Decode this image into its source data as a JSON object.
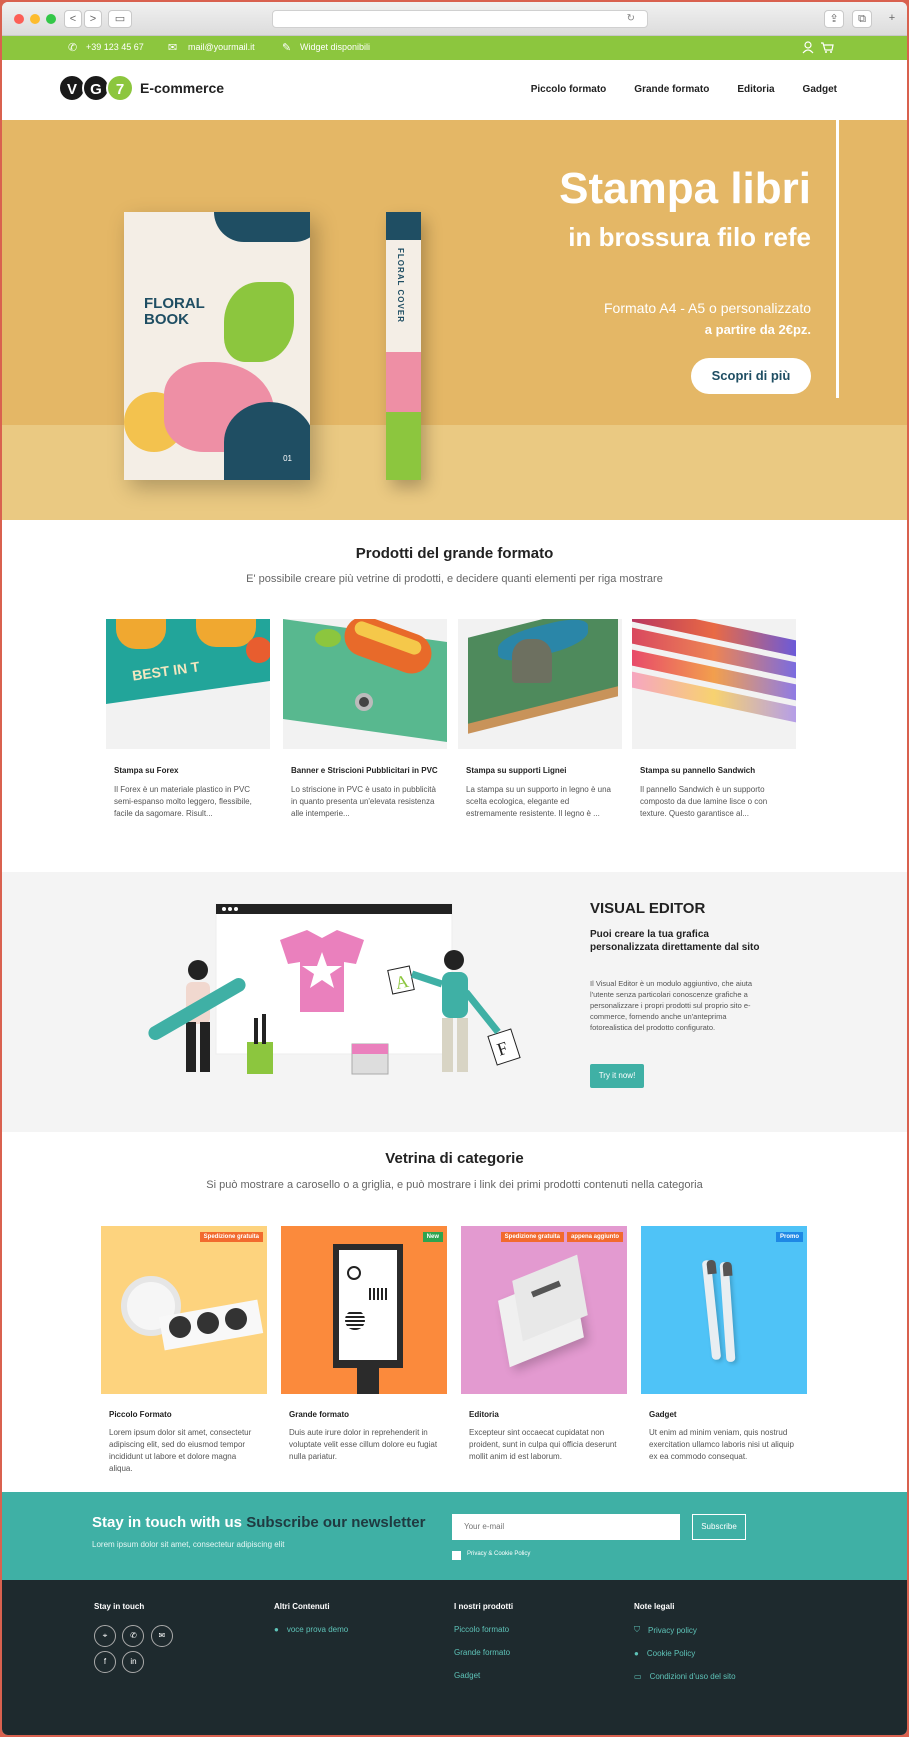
{
  "browser": {
    "back": "<",
    "forward": ">",
    "sidebar_icon": "▭",
    "reload": "↻",
    "share": "⇪",
    "tabs": "⧉",
    "new_tab": "+"
  },
  "topbar": {
    "phone": "+39 123 45 67",
    "email": "mail@yourmail.it",
    "widget": "Widget disponibili",
    "colors": {
      "bg": "#8cc63e"
    }
  },
  "header": {
    "logo_letters": [
      "V",
      "G",
      "7"
    ],
    "brand": "E-commerce",
    "menu": [
      "Piccolo formato",
      "Grande formato",
      "Editoria",
      "Gadget"
    ]
  },
  "hero": {
    "title": "Stampa libri",
    "subtitle": "in brossura filo refe",
    "line1": "Formato A4 - A5 o personalizzato",
    "line2": "a partire da 2€pz.",
    "button": "Scopri di più",
    "book_title": "FLORAL BOOK",
    "book_num": "01",
    "spine_text": "FLORAL COVER"
  },
  "products": {
    "title": "Prodotti del grande formato",
    "subtitle": "E' possibile creare più vetrine di prodotti, e decidere quanti elementi per riga mostrare",
    "items": [
      {
        "name": "Stampa su Forex",
        "desc": "Il Forex è un materiale plastico in PVC semi-espanso molto leggero, flessibile, facile da sagomare. Risult..."
      },
      {
        "name": "Banner e Striscioni Pubblicitari in PVC",
        "desc": "Lo striscione in PVC è usato in pubblicità in quanto presenta un'elevata resistenza alle intemperie..."
      },
      {
        "name": "Stampa su supporti Lignei",
        "desc": "La stampa su un supporto in legno è una scelta ecologica, elegante ed estremamente resistente. Il legno è ..."
      },
      {
        "name": "Stampa su pannello Sandwich",
        "desc": "Il pannello Sandwich è un supporto composto da due lamine lisce o con texture. Questo garantisce al..."
      }
    ],
    "forex_text": "BEST IN T"
  },
  "editor": {
    "title": "VISUAL EDITOR",
    "subtitle": "Puoi creare la tua grafica personalizzata direttamente dal sito",
    "body": "Il Visual Editor è un modulo aggiuntivo, che aiuta l'utente senza particolari conoscenze grafiche a personalizzare i propri prodotti sul proprio sito e-commerce, fornendo anche un'anteprima fotorealistica del prodotto configurato.",
    "button": "Try it now!",
    "letters": [
      "A",
      "F"
    ]
  },
  "categories": {
    "title": "Vetrina di categorie",
    "subtitle": "Si può mostrare a carosello o a griglia, e può mostrare i link dei primi prodotti contenuti nella categoria",
    "items": [
      {
        "name": "Piccolo Formato",
        "desc": "Lorem ipsum dolor sit amet, consectetur adipiscing elit, sed do eiusmod tempor incididunt ut labore et dolore magna aliqua.",
        "badges": [
          {
            "text": "Spedizione gratuita",
            "color": "#f26a2e"
          }
        ],
        "bg": "#fdd37e"
      },
      {
        "name": "Grande formato",
        "desc": "Duis aute irure dolor in reprehenderit in voluptate velit esse cillum dolore eu fugiat nulla pariatur.",
        "badges": [
          {
            "text": "New",
            "color": "#2ea44f"
          }
        ],
        "bg": "#fb8a3c"
      },
      {
        "name": "Editoria",
        "desc": "Excepteur sint occaecat cupidatat non proident, sunt in culpa qui officia deserunt mollit anim id est laborum.",
        "badges": [
          {
            "text": "Spedizione gratuita",
            "color": "#f26a2e"
          },
          {
            "text": "appena aggiunto",
            "color": "#f26a2e"
          }
        ],
        "bg": "#e39ad0"
      },
      {
        "name": "Gadget",
        "desc": "Ut enim ad minim veniam, quis nostrud exercitation ullamco laboris nisi ut aliquip ex ea commodo consequat.",
        "badges": [
          {
            "text": "Promo",
            "color": "#1e88e5"
          }
        ],
        "bg": "#4fc3f7"
      }
    ]
  },
  "newsletter": {
    "title_white": "Stay in touch with us",
    "title_dark": "Subscribe our newsletter",
    "text": "Lorem ipsum dolor sit amet, consectetur adipiscing elit",
    "placeholder": "Your e-mail",
    "button": "Subscribe",
    "privacy": "Privacy & Cookie Policy"
  },
  "footer": {
    "col1": {
      "title": "Stay in touch",
      "icons": [
        "⌖",
        "✆",
        "✉",
        "f",
        "in"
      ]
    },
    "col2": {
      "title": "Altri Contenuti",
      "links": [
        "voce prova demo"
      ]
    },
    "col3": {
      "title": "I nostri prodotti",
      "links": [
        "Piccolo formato",
        "Grande formato",
        "Gadget"
      ]
    },
    "col4": {
      "title": "Note legali",
      "links": [
        "Privacy policy",
        "Cookie Policy",
        "Condizioni d'uso del sito"
      ]
    }
  }
}
